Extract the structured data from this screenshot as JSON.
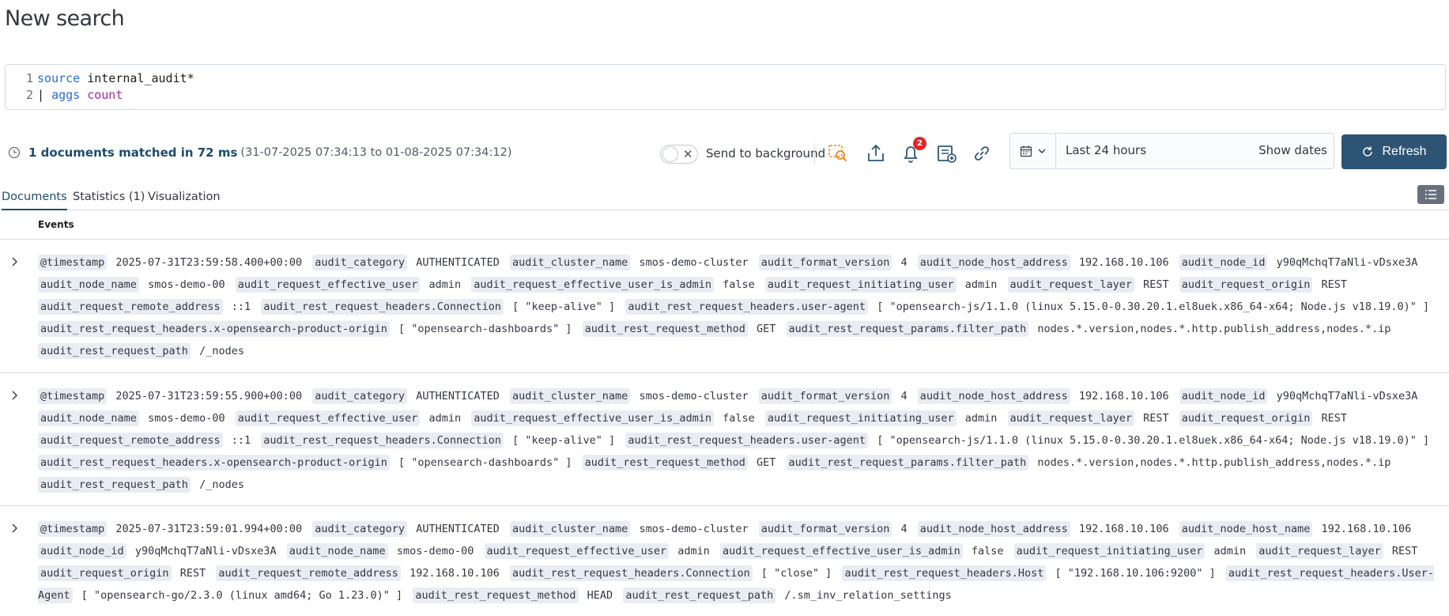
{
  "page": {
    "title": "New search"
  },
  "query": {
    "lines": [
      {
        "num": "1",
        "keyword": "source",
        "rest": " internal_audit*"
      },
      {
        "num": "2",
        "pipe": "| ",
        "keyword": "aggs",
        "fn": " count"
      }
    ]
  },
  "status": {
    "matched": "1 documents matched in 72 ms",
    "range": "(31-07-2025 07:34:13 to 01-08-2025 07:34:12)",
    "send_to_background": "Send to background",
    "alerts_badge": "2",
    "date_label": "Last 24 hours",
    "show_dates": "Show dates",
    "refresh": "Refresh"
  },
  "icons": {
    "clock": "clock-icon",
    "toggle_off": "close-icon",
    "inspect": "inspect-icon",
    "share": "share-icon",
    "alerts": "bell-icon",
    "save": "save-icon",
    "link": "link-icon",
    "calendar": "calendar-icon",
    "chevron": "chevron-down-icon",
    "refresh": "refresh-icon",
    "table_view": "list-icon",
    "expand": "chevron-right-icon"
  },
  "colors": {
    "accent": "#1d4c6f",
    "refresh_bg": "#2d5474",
    "field_bg": "#e9edf3",
    "badge": "#e02727"
  },
  "tabs": [
    {
      "label": "Documents",
      "active": true
    },
    {
      "label": "Statistics (1)",
      "active": false
    },
    {
      "label": "Visualization",
      "active": false
    }
  ],
  "events_header": "Events",
  "rows": [
    {
      "pairs": [
        [
          "@timestamp",
          "2025-07-31T23:59:58.400+00:00"
        ],
        [
          "audit_category",
          "AUTHENTICATED"
        ],
        [
          "audit_cluster_name",
          "smos-demo-cluster"
        ],
        [
          "audit_format_version",
          "4"
        ],
        [
          "audit_node_host_address",
          "192.168.10.106"
        ],
        [
          "audit_node_id",
          "y90qMchqT7aNli-vDsxe3A"
        ],
        [
          "audit_node_name",
          "smos-demo-00"
        ],
        [
          "audit_request_effective_user",
          "admin"
        ],
        [
          "audit_request_effective_user_is_admin",
          "false"
        ],
        [
          "audit_request_initiating_user",
          "admin"
        ],
        [
          "audit_request_layer",
          "REST"
        ],
        [
          "audit_request_origin",
          "REST"
        ],
        [
          "audit_request_remote_address",
          "::1"
        ],
        [
          "audit_rest_request_headers.Connection",
          "[ \"keep-alive\" ]"
        ],
        [
          "audit_rest_request_headers.user-agent",
          "[ \"opensearch-js/1.1.0 (linux 5.15.0-0.30.20.1.el8uek.x86_64-x64; Node.js v18.19.0)\" ]"
        ],
        [
          "audit_rest_request_headers.x-opensearch-product-origin",
          "[ \"opensearch-dashboards\" ]"
        ],
        [
          "audit_rest_request_method",
          "GET"
        ],
        [
          "audit_rest_request_params.filter_path",
          "nodes.*.version,nodes.*.http.publish_address,nodes.*.ip"
        ],
        [
          "audit_rest_request_path",
          "/_nodes"
        ]
      ]
    },
    {
      "pairs": [
        [
          "@timestamp",
          "2025-07-31T23:59:55.900+00:00"
        ],
        [
          "audit_category",
          "AUTHENTICATED"
        ],
        [
          "audit_cluster_name",
          "smos-demo-cluster"
        ],
        [
          "audit_format_version",
          "4"
        ],
        [
          "audit_node_host_address",
          "192.168.10.106"
        ],
        [
          "audit_node_id",
          "y90qMchqT7aNli-vDsxe3A"
        ],
        [
          "audit_node_name",
          "smos-demo-00"
        ],
        [
          "audit_request_effective_user",
          "admin"
        ],
        [
          "audit_request_effective_user_is_admin",
          "false"
        ],
        [
          "audit_request_initiating_user",
          "admin"
        ],
        [
          "audit_request_layer",
          "REST"
        ],
        [
          "audit_request_origin",
          "REST"
        ],
        [
          "audit_request_remote_address",
          "::1"
        ],
        [
          "audit_rest_request_headers.Connection",
          "[ \"keep-alive\" ]"
        ],
        [
          "audit_rest_request_headers.user-agent",
          "[ \"opensearch-js/1.1.0 (linux 5.15.0-0.30.20.1.el8uek.x86_64-x64; Node.js v18.19.0)\" ]"
        ],
        [
          "audit_rest_request_headers.x-opensearch-product-origin",
          "[ \"opensearch-dashboards\" ]"
        ],
        [
          "audit_rest_request_method",
          "GET"
        ],
        [
          "audit_rest_request_params.filter_path",
          "nodes.*.version,nodes.*.http.publish_address,nodes.*.ip"
        ],
        [
          "audit_rest_request_path",
          "/_nodes"
        ]
      ]
    },
    {
      "pairs": [
        [
          "@timestamp",
          "2025-07-31T23:59:01.994+00:00"
        ],
        [
          "audit_category",
          "AUTHENTICATED"
        ],
        [
          "audit_cluster_name",
          "smos-demo-cluster"
        ],
        [
          "audit_format_version",
          "4"
        ],
        [
          "audit_node_host_address",
          "192.168.10.106"
        ],
        [
          "audit_node_host_name",
          "192.168.10.106"
        ],
        [
          "audit_node_id",
          "y90qMchqT7aNli-vDsxe3A"
        ],
        [
          "audit_node_name",
          "smos-demo-00"
        ],
        [
          "audit_request_effective_user",
          "admin"
        ],
        [
          "audit_request_effective_user_is_admin",
          "false"
        ],
        [
          "audit_request_initiating_user",
          "admin"
        ],
        [
          "audit_request_layer",
          "REST"
        ],
        [
          "audit_request_origin",
          "REST"
        ],
        [
          "audit_request_remote_address",
          "192.168.10.106"
        ],
        [
          "audit_rest_request_headers.Connection",
          "[ \"close\" ]"
        ],
        [
          "audit_rest_request_headers.Host",
          "[ \"192.168.10.106:9200\" ]"
        ],
        [
          "audit_rest_request_headers.User-Agent",
          "[ \"opensearch-go/2.3.0 (linux amd64; Go 1.23.0)\" ]"
        ],
        [
          "audit_rest_request_method",
          "HEAD"
        ],
        [
          "audit_rest_request_path",
          "/.sm_inv_relation_settings"
        ]
      ]
    }
  ]
}
